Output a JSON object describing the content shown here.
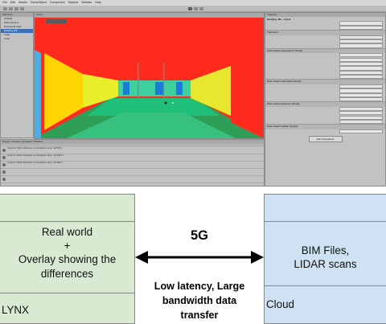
{
  "screenshot": {
    "menu_items": [
      "File",
      "Edit",
      "Assets",
      "GameObject",
      "Component",
      "Mapbox",
      "Window",
      "Help"
    ],
    "hierarchy": {
      "tab": "Hierarchy",
      "rows": [
        "Untitled",
        "Main Camera",
        "Directional Light",
        "Building_Mb",
        "Cube",
        "Cube"
      ]
    },
    "scene": {
      "tab": "Scene"
    },
    "inspector": {
      "tab": "Inspector",
      "object_name": "Building_Mb - Cloud",
      "sections": [
        "Transform",
        "Point Cloud Appearance (Script)",
        "Point Cloud Color Data (Script)",
        "Point Cloud Streamer (Script)",
        "Point Cloud Collider (Script)"
      ],
      "add_component": "Add Component"
    },
    "console": {
      "tabs": [
        "Project",
        "Console",
        "Animation",
        "Timeline"
      ],
      "messages": [
        "Cloud to Mesh Distance computation time: 12.878 s",
        "Cloud to Mesh Distance computation time: 10.2357 s",
        "Cloud to Mesh Distance computation time: 11.059 s"
      ]
    }
  },
  "diagram": {
    "left_main": "Real world\n+\nOverlay showing the\ndifferences",
    "left_label": "LYNX",
    "right_main": "BIM Files,\nLIDAR scans",
    "right_label": "Cloud",
    "link_title": "5G",
    "link_note": "Low latency, Large\nbandwidth data\ntransfer",
    "colors": {
      "left_fill": "#d9ead3",
      "right_fill": "#cfe2f3",
      "arrow": "#000000"
    }
  }
}
